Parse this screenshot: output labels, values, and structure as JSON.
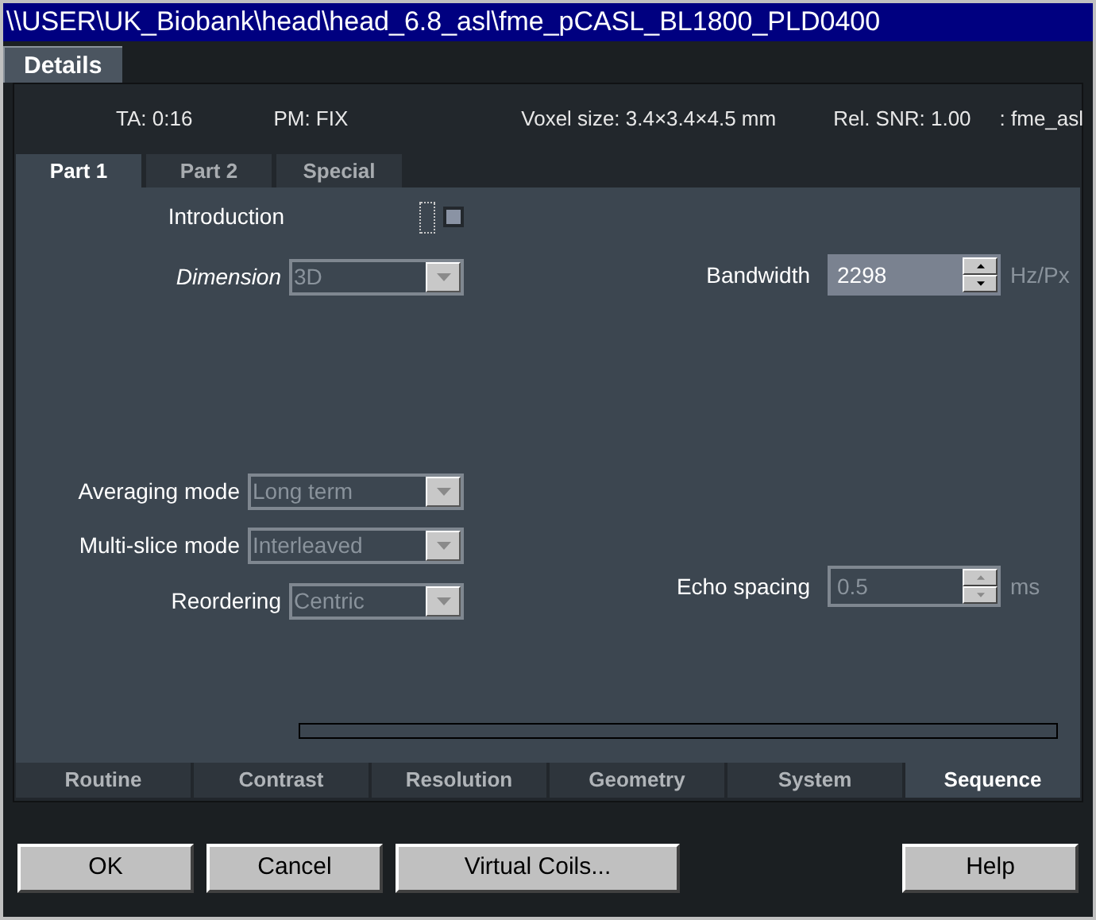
{
  "window": {
    "title": "\\\\USER\\UK_Biobank\\head\\head_6.8_asl\\fme_pCASL_BL1800_PLD0400"
  },
  "top_tabs": [
    {
      "label": "Details",
      "selected": true
    }
  ],
  "info": [
    "TA: 0:16",
    "PM: FIX",
    "Voxel size: 3.4×3.4×4.5 mm",
    "Rel. SNR: 1.00",
    ": fme_asl"
  ],
  "sub_tabs": [
    {
      "label": "Part 1",
      "selected": true
    },
    {
      "label": "Part 2",
      "selected": false
    },
    {
      "label": "Special",
      "selected": false
    }
  ],
  "left_fields": [
    {
      "kind": "checkbox",
      "label": "Introduction",
      "checked": false
    },
    {
      "kind": "dropdown",
      "label": "Dimension",
      "value": "3D",
      "italic": true,
      "disabled": true
    },
    {
      "kind": "dropdown",
      "label": "Averaging mode",
      "value": "Long term",
      "italic": false,
      "disabled": true
    },
    {
      "kind": "dropdown",
      "label": "Multi-slice mode",
      "value": "Interleaved",
      "italic": false,
      "disabled": true
    },
    {
      "kind": "dropdown",
      "label": "Reordering",
      "value": "Centric",
      "italic": false,
      "disabled": true
    }
  ],
  "right_fields": [
    {
      "label": "Bandwidth",
      "value": "2298",
      "unit": "Hz/Px",
      "disabled": false
    },
    {
      "label": "Echo spacing",
      "value": "0.5",
      "unit": "ms",
      "disabled": true
    }
  ],
  "progress": {
    "level": 0
  },
  "bottom_tabs": [
    {
      "label": "Routine",
      "selected": false
    },
    {
      "label": "Contrast",
      "selected": false
    },
    {
      "label": "Resolution",
      "selected": false
    },
    {
      "label": "Geometry",
      "selected": false
    },
    {
      "label": "System",
      "selected": false
    },
    {
      "label": "Sequence",
      "selected": true
    }
  ],
  "buttons": [
    "OK",
    "Cancel",
    "Virtual Coils...",
    "Help"
  ]
}
